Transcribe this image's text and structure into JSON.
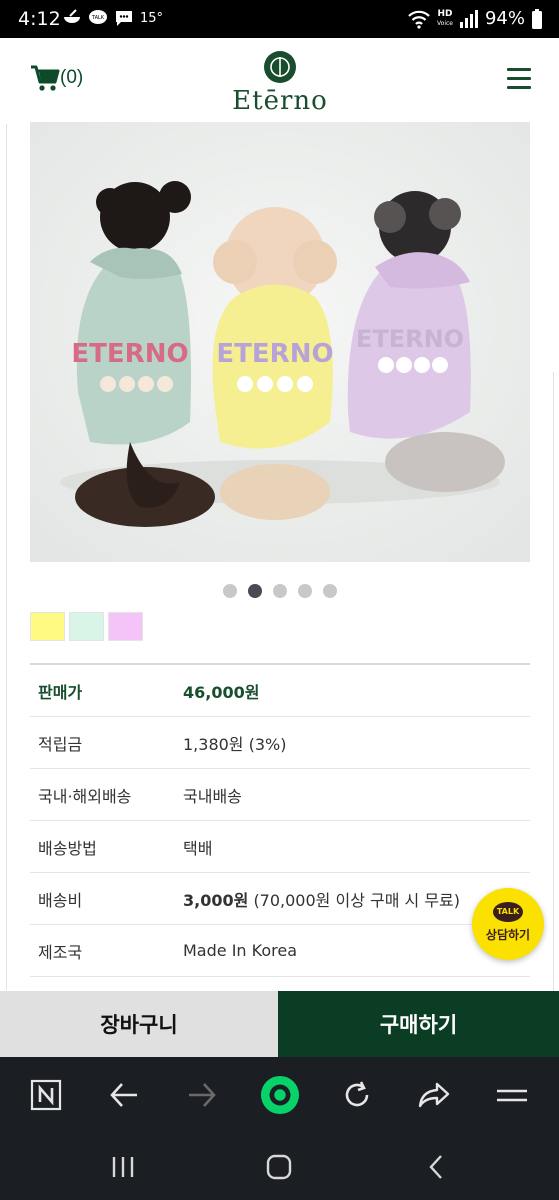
{
  "status_bar": {
    "time": "4:12",
    "temperature": "15°",
    "network": "HD",
    "network_sub": "Voice",
    "battery": "94%"
  },
  "header": {
    "cart_count": "(0)",
    "logo_text": "Etērno"
  },
  "gallery": {
    "image_index": 2,
    "image_count": 5
  },
  "colors": [
    "#fffa82",
    "#d9f5e8",
    "#f4c4f8"
  ],
  "product_info": {
    "price_label": "판매가",
    "price_value": "46,000원",
    "points_label": "적립금",
    "points_value": "1,380원 (3%)",
    "delivery_region_label": "국내·해외배송",
    "delivery_region_value": "국내배송",
    "delivery_method_label": "배송방법",
    "delivery_method_value": "택배",
    "shipping_fee_label": "배송비",
    "shipping_fee_amount": "3,000원",
    "shipping_fee_note": "(70,000원 이상 구매 시 무료)",
    "origin_label": "제조국",
    "origin_value": "Made In Korea"
  },
  "chat": {
    "badge": "TALK",
    "label": "상담하기"
  },
  "cta": {
    "cart_label": "장바구니",
    "buy_label": "구매하기"
  },
  "browser_bar": [
    "naver-n-icon",
    "back-icon",
    "forward-icon",
    "home-icon",
    "refresh-icon",
    "share-icon",
    "menu-icon"
  ],
  "system_nav": [
    "recents-icon",
    "home-icon",
    "back-icon"
  ]
}
